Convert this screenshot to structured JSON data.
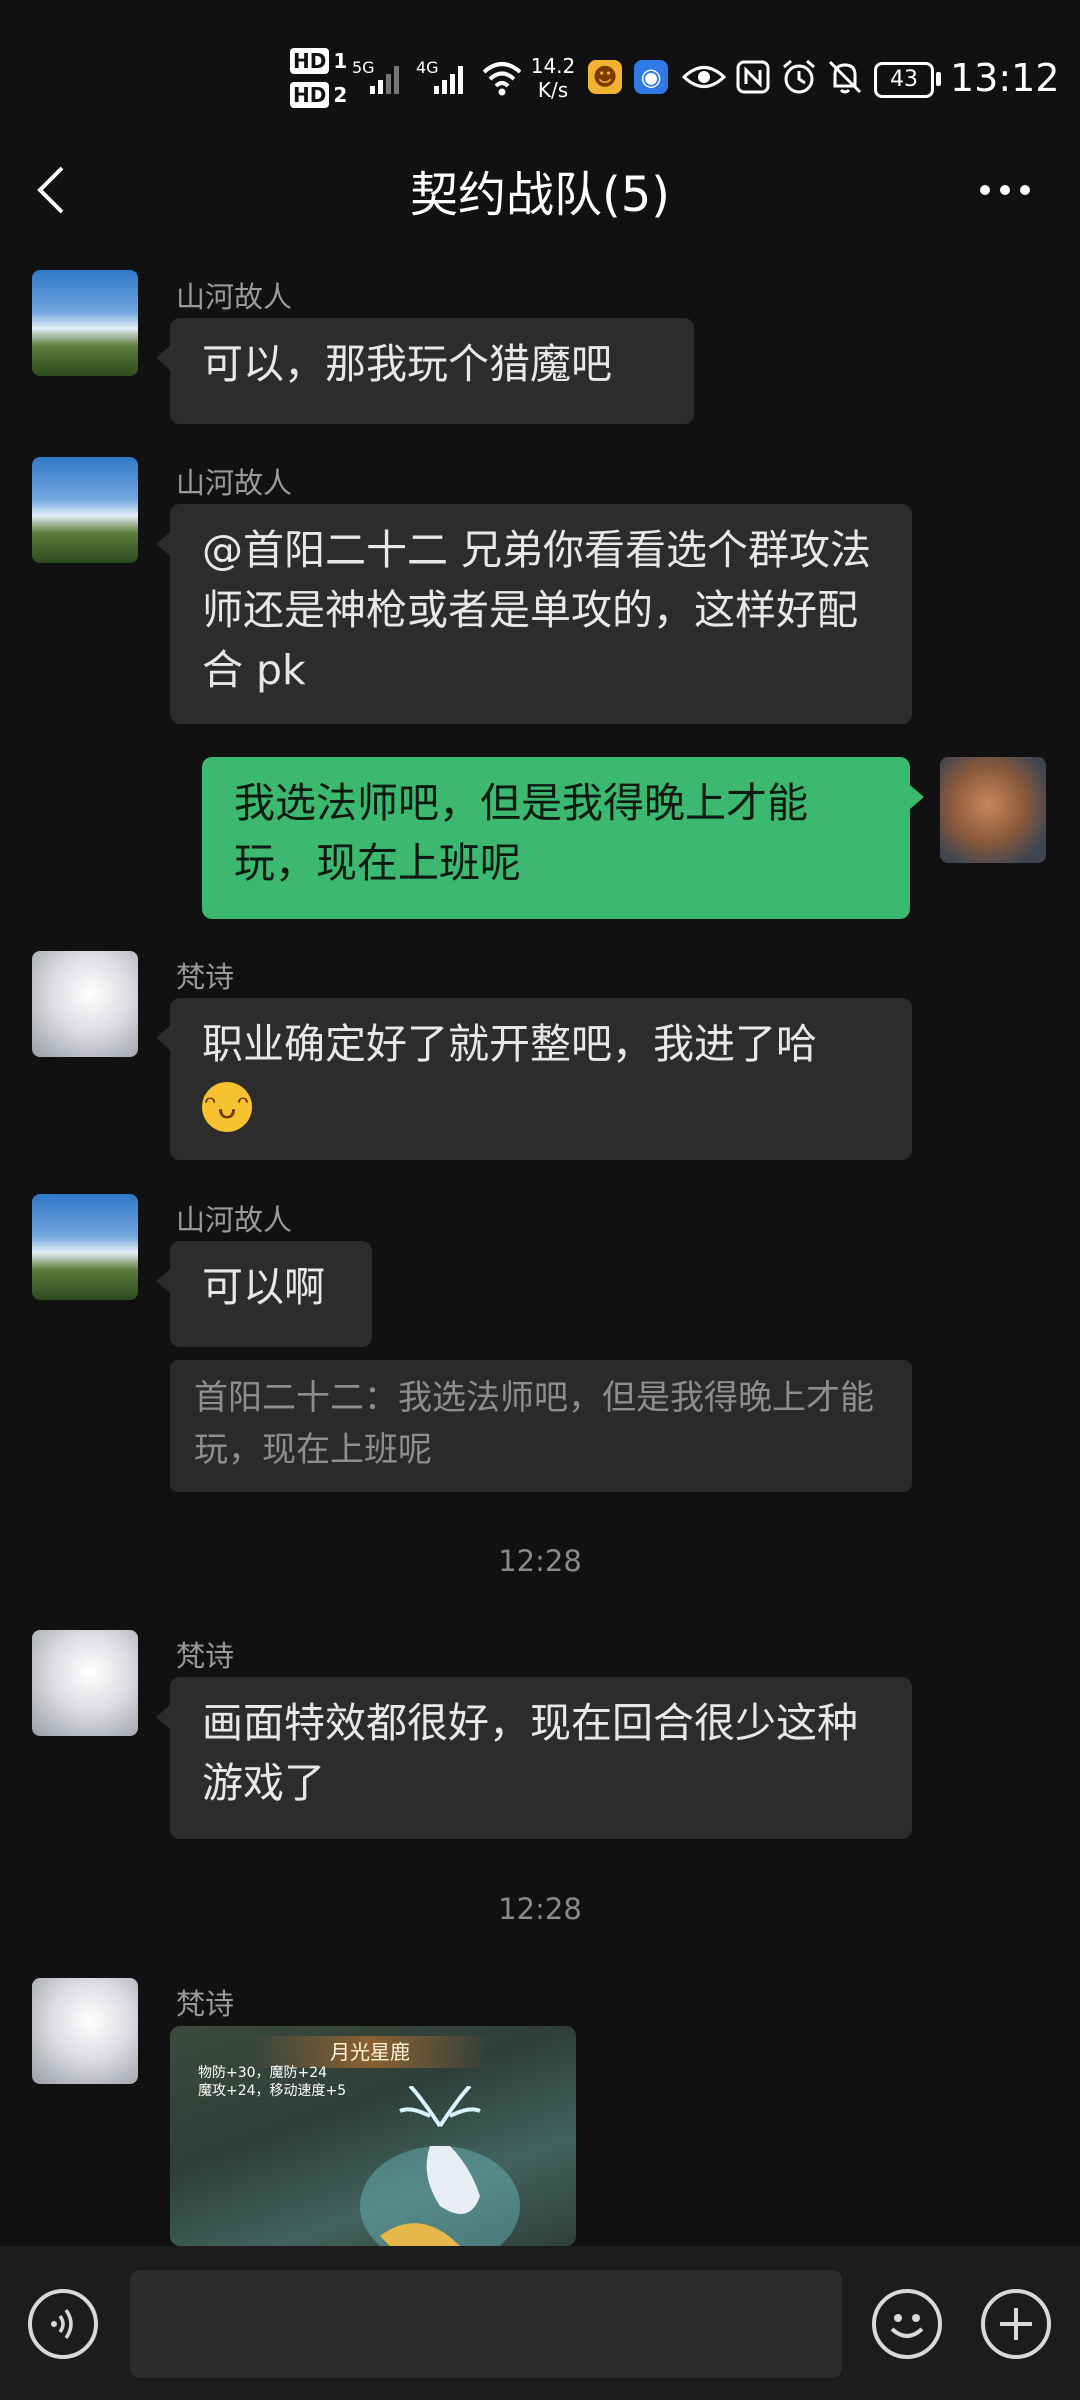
{
  "status_bar": {
    "hd1": "HD",
    "hd1_sim": "1",
    "hd2": "HD",
    "hd2_sim": "2",
    "net1": "5G",
    "net2": "4G",
    "speed_value": "14.2",
    "speed_unit": "K/s",
    "battery": "43",
    "time": "13:12"
  },
  "header": {
    "title": "契约战队(5)"
  },
  "messages": [
    {
      "sender": "山河故人",
      "text": "可以，那我玩个猎魔吧"
    },
    {
      "sender": "山河故人",
      "text": "@首阳二十二  兄弟你看看选个群攻法师还是神枪或者是单攻的，这样好配合 pk"
    },
    {
      "sender": "self",
      "text": "我选法师吧，但是我得晚上才能玩，现在上班呢"
    },
    {
      "sender": "梵诗",
      "text": "职业确定好了就开整吧，我进了哈"
    },
    {
      "sender": "山河故人",
      "text": "可以啊",
      "quote": "首阳二十二：我选法师吧，但是我得晚上才能玩，现在上班呢"
    },
    {
      "sender": "梵诗",
      "text": "画面特效都很好，现在回合很少这种游戏了"
    },
    {
      "sender": "梵诗",
      "image": {
        "banner": "月光星鹿",
        "stats_line1": "物防+30，魔防+24",
        "stats_line2": "魔攻+24，移动速度+5"
      }
    }
  ],
  "timestamps": [
    "12:28",
    "12:28"
  ],
  "icons": {
    "back": "chevron-left-icon",
    "more": "more-dots-icon",
    "voice": "voice-icon",
    "emoji": "smiley-icon",
    "plus": "plus-icon"
  },
  "colors": {
    "background": "#111111",
    "bubble_other": "#2c2c2c",
    "bubble_self": "#3db870"
  }
}
